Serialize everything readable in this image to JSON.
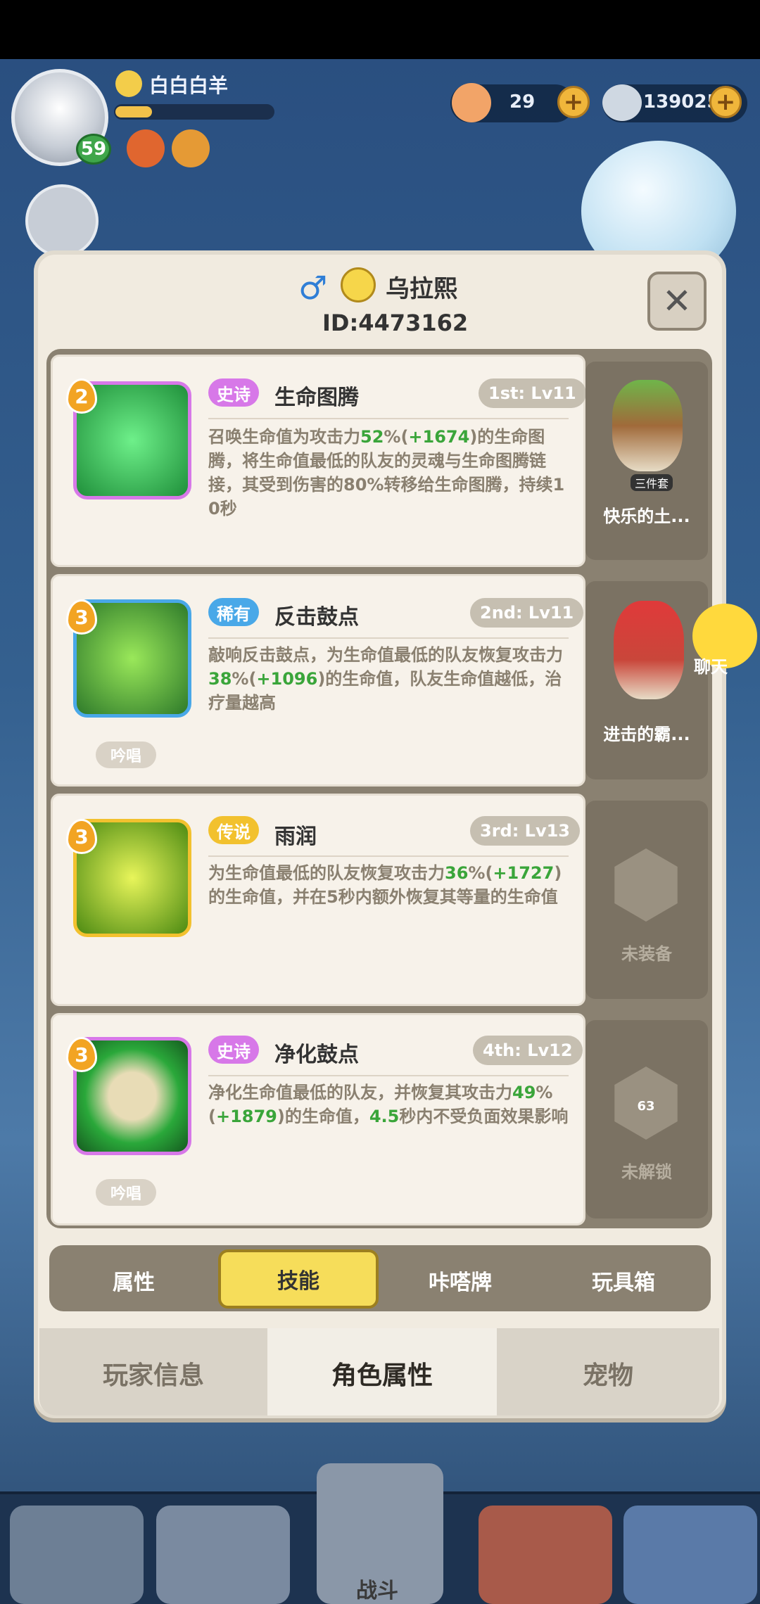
{
  "player": {
    "name": "白白白羊",
    "level": "59"
  },
  "currency": {
    "shells": "29",
    "crystals": "139025"
  },
  "hero": {
    "gender_icon": "male-symbol-icon",
    "name": "乌拉熙",
    "id": "ID:4473162"
  },
  "skills": [
    {
      "badge": "2",
      "rarity": "史诗",
      "rarity_color": "#d778e8",
      "name": "生命图腾",
      "slot": "1st: Lv11",
      "desc": [
        "召唤生命值为攻击力",
        "52",
        "%(",
        "+1674",
        ")的生命图腾，将生命值最低的队友的灵魂与生命图腾链接，其受到伤害的80%转移给生命图腾，持续10秒"
      ],
      "chant": "",
      "side_label": "快乐的土...",
      "side_tag": "三件套"
    },
    {
      "badge": "3",
      "rarity": "稀有",
      "rarity_color": "#49a8e8",
      "name": "反击鼓点",
      "slot": "2nd: Lv11",
      "desc": [
        "敲响反击鼓点，为生命值最低的队友恢复攻击力",
        "38",
        "%(",
        "+1096",
        ")的生命值，队友生命值越低，治疗量越高"
      ],
      "chant": "吟唱",
      "side_label": "进击的霸...",
      "side_tag": ""
    },
    {
      "badge": "3",
      "rarity": "传说",
      "rarity_color": "#f2c12e",
      "name": "雨润",
      "slot": "3rd: Lv13",
      "desc": [
        "为生命值最低的队友恢复攻击力",
        "36",
        "%(",
        "+1727",
        ")的生命值，并在5秒内额外恢复其等量的生命值"
      ],
      "chant": "",
      "side_label": "未装备",
      "side_tag": ""
    },
    {
      "badge": "3",
      "rarity": "史诗",
      "rarity_color": "#d778e8",
      "name": "净化鼓点",
      "slot": "4th: Lv12",
      "desc": [
        "净化生命值最低的队友，并恢复其攻击力",
        "49",
        "%(",
        "+1879",
        ")的生命值，",
        "4.5",
        "秒内不受负面效果影响"
      ],
      "chant": "吟唱",
      "side_label": "未解锁",
      "side_tag": "63"
    }
  ],
  "tabs": [
    "属性",
    "技能",
    "咔嗒牌",
    "玩具箱"
  ],
  "bottom_tabs": [
    "玩家信息",
    "角色属性",
    "宠物"
  ],
  "chat": "聊天",
  "nav_battle": "战斗"
}
